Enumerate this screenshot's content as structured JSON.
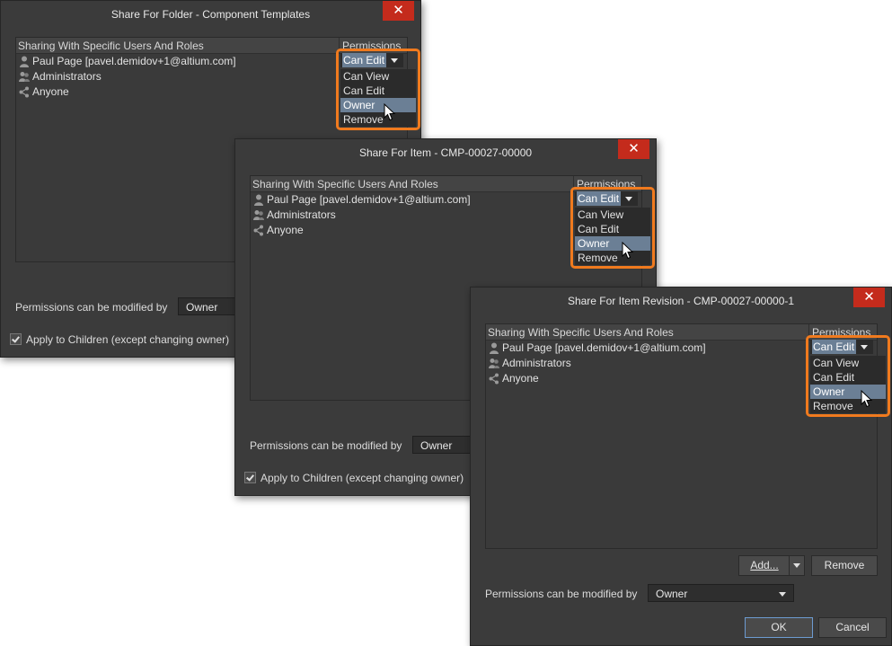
{
  "dialogs": [
    {
      "title": "Share For Folder - Component Templates",
      "close_label": "✕",
      "list": {
        "col_users": "Sharing With Specific Users And Roles",
        "col_permissions": "Permissions",
        "rows": [
          {
            "label": "Paul Page [pavel.demidov+1@altium.com]",
            "icon": "user-icon"
          },
          {
            "label": "Administrators",
            "icon": "group-icon"
          },
          {
            "label": "Anyone",
            "icon": "share-icon"
          }
        ]
      },
      "dropdown": {
        "value": "Can Edit",
        "options": [
          "Can View",
          "Can Edit",
          "Owner",
          "Remove"
        ],
        "highlighted": "Owner"
      },
      "modified_by_label": "Permissions can be modified by",
      "modified_by_value": "Owner",
      "apply_children_label": "Apply to Children (except changing owner)"
    },
    {
      "title": "Share For Item - CMP-00027-00000",
      "close_label": "✕",
      "list": {
        "col_users": "Sharing With Specific Users And Roles",
        "col_permissions": "Permissions",
        "rows": [
          {
            "label": "Paul Page [pavel.demidov+1@altium.com]",
            "icon": "user-icon"
          },
          {
            "label": "Administrators",
            "icon": "group-icon"
          },
          {
            "label": "Anyone",
            "icon": "share-icon"
          }
        ]
      },
      "dropdown": {
        "value": "Can Edit",
        "options": [
          "Can View",
          "Can Edit",
          "Owner",
          "Remove"
        ],
        "highlighted": "Owner"
      },
      "modified_by_label": "Permissions can be modified by",
      "modified_by_value": "Owner",
      "apply_children_label": "Apply to Children (except changing owner)"
    },
    {
      "title": "Share For Item Revision - CMP-00027-00000-1",
      "close_label": "✕",
      "list": {
        "col_users": "Sharing With Specific Users And Roles",
        "col_permissions": "Permissions",
        "rows": [
          {
            "label": "Paul Page [pavel.demidov+1@altium.com]",
            "icon": "user-icon"
          },
          {
            "label": "Administrators",
            "icon": "group-icon"
          },
          {
            "label": "Anyone",
            "icon": "share-icon"
          }
        ]
      },
      "dropdown": {
        "value": "Can Edit",
        "options": [
          "Can View",
          "Can Edit",
          "Owner",
          "Remove"
        ],
        "highlighted": "Owner"
      },
      "add_button": "Add...",
      "remove_button": "Remove",
      "modified_by_label": "Permissions can be modified by",
      "modified_by_value": "Owner",
      "ok_button": "OK",
      "cancel_button": "Cancel"
    }
  ],
  "colors": {
    "highlight_outline": "#f07a1e",
    "selection": "#6b7f95",
    "close_button": "#c42b1c",
    "dialog_bg": "#3b3b3b"
  }
}
